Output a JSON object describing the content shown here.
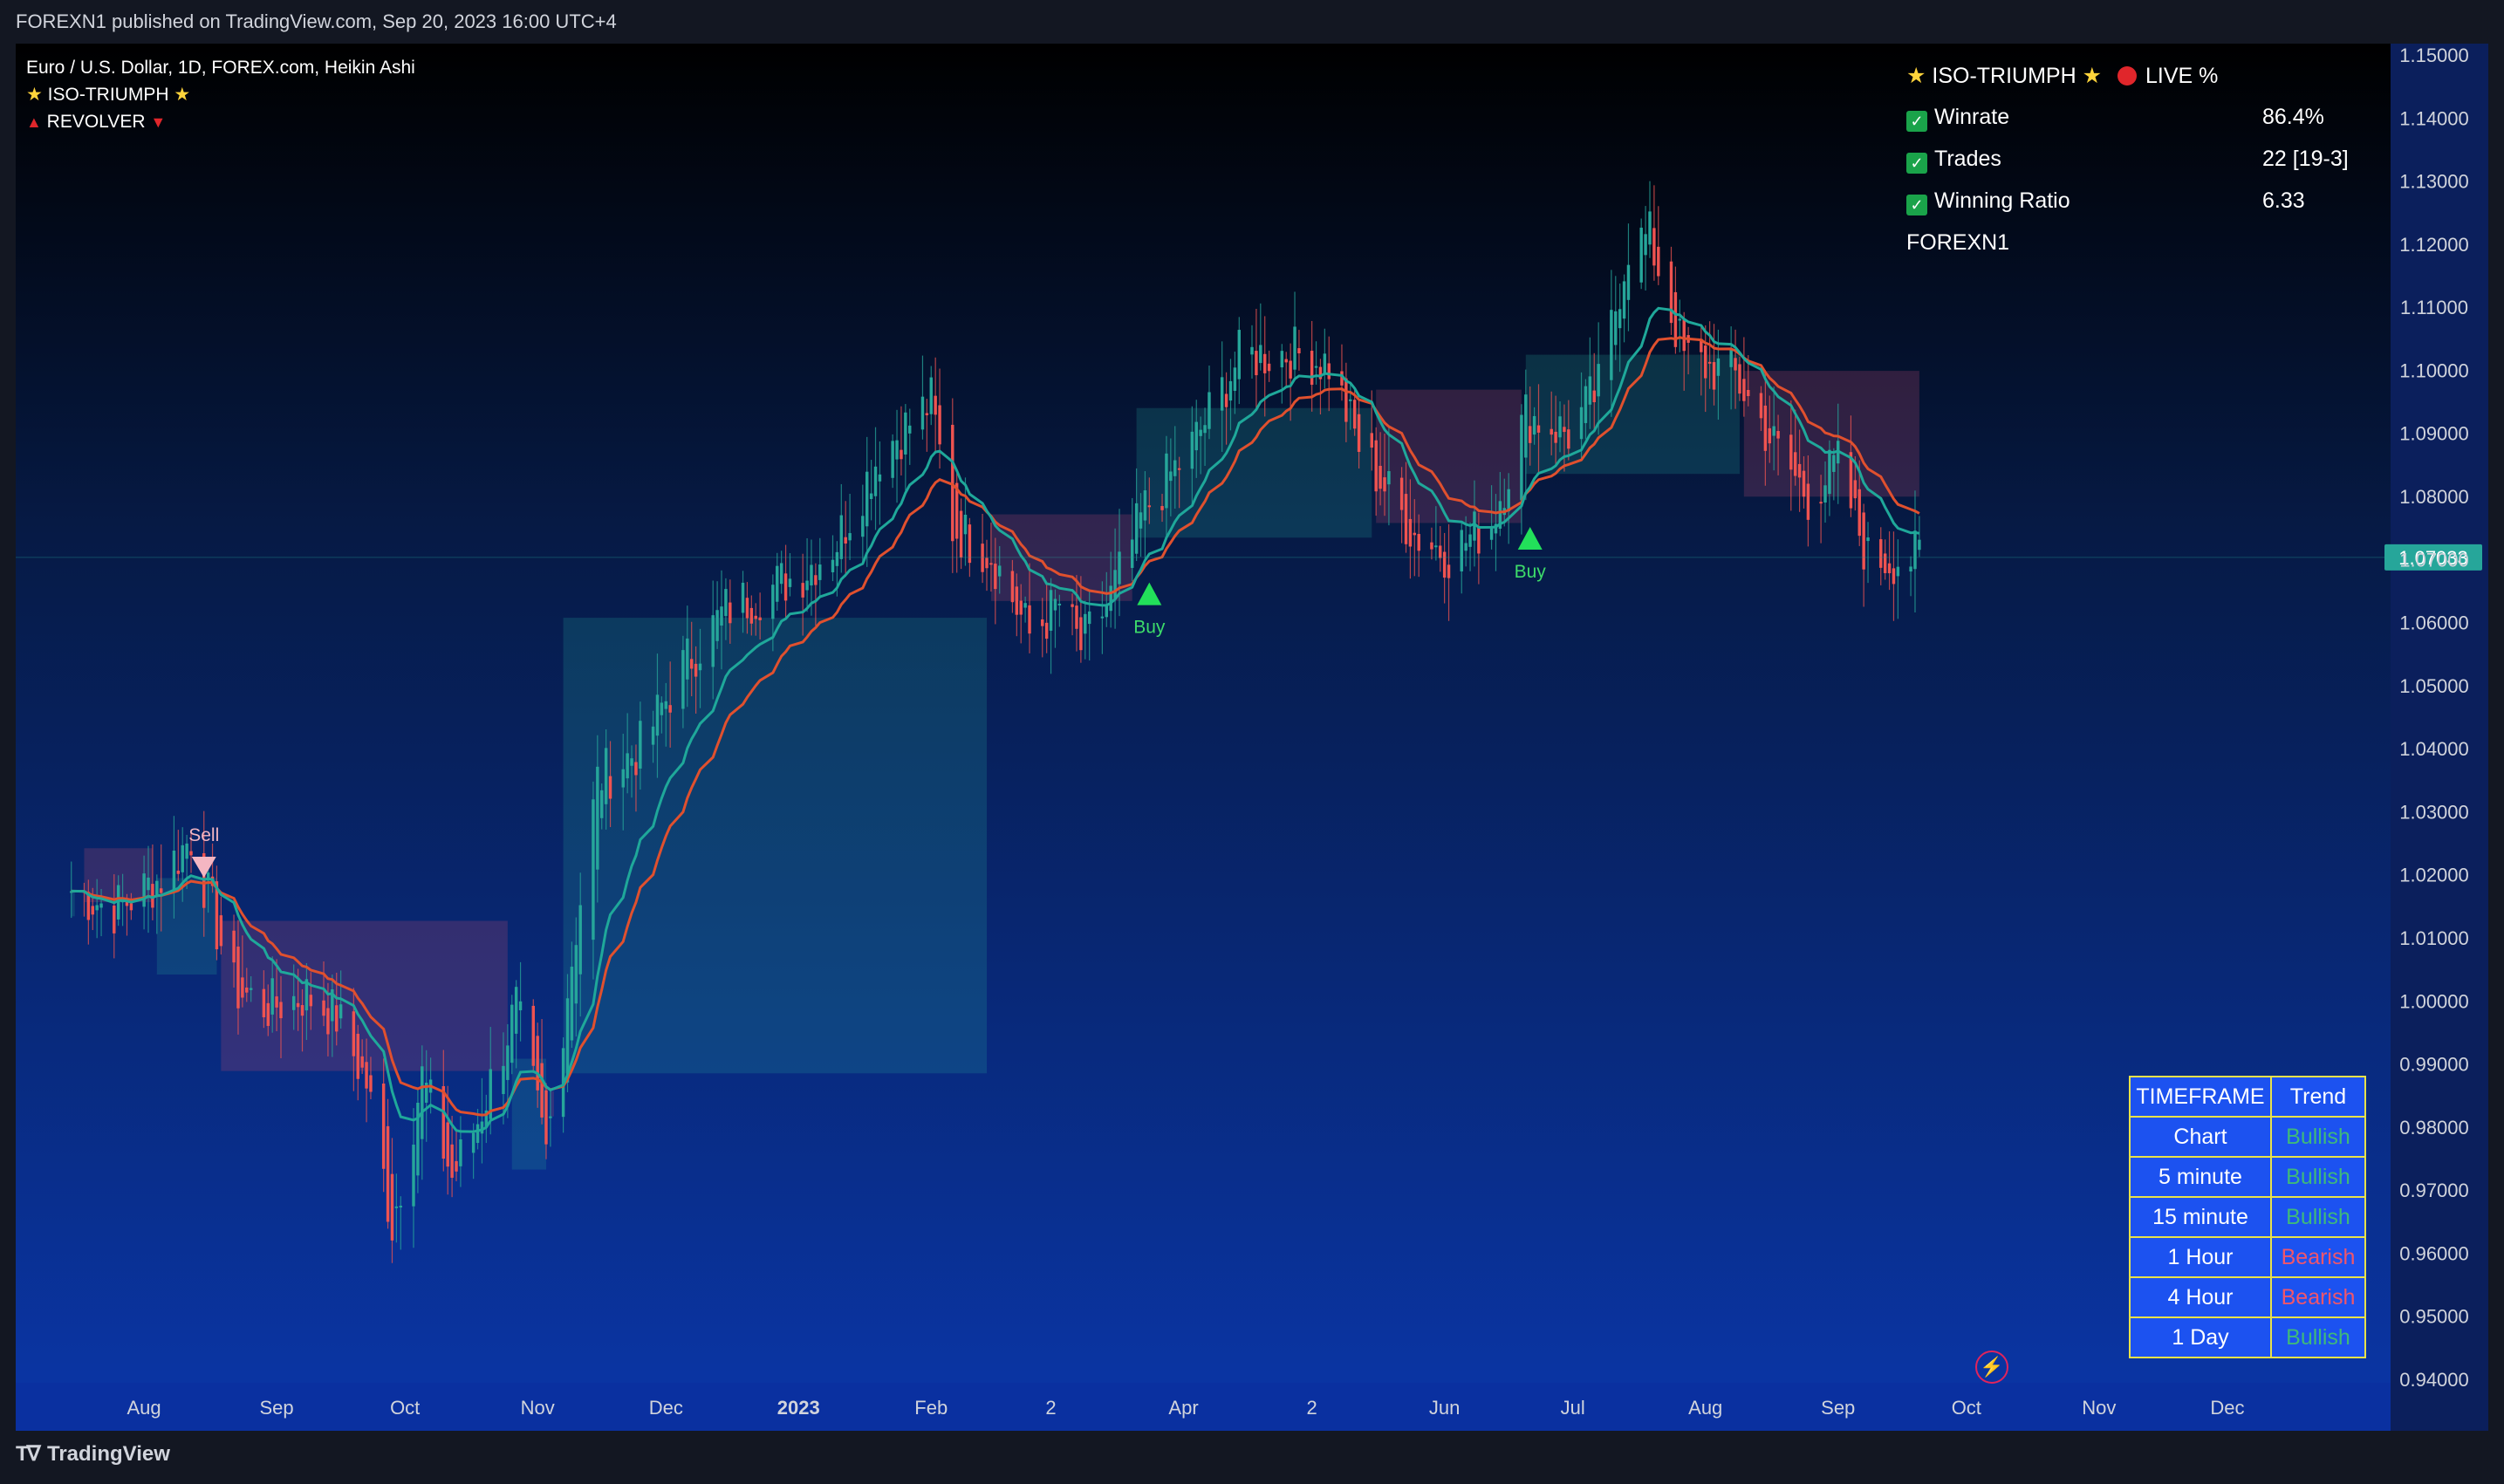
{
  "header": {
    "published": "FOREXN1 published on TradingView.com, Sep 20, 2023 16:00 UTC+4"
  },
  "footer": {
    "brand": "TradingView",
    "logo_icon": "tradingview-logo-icon"
  },
  "legend": {
    "symbol": "Euro / U.S. Dollar, 1D, FOREX.com, Heikin Ashi",
    "indicator1": "ISO-TRIUMPH",
    "indicator2": "REVOLVER"
  },
  "stats": {
    "title": "ISO-TRIUMPH",
    "live": "LIVE %",
    "rows": [
      {
        "label": "Winrate",
        "value": "86.4%"
      },
      {
        "label": "Trades",
        "value": "22 [19-3]"
      },
      {
        "label": "Winning Ratio",
        "value": "6.33"
      }
    ],
    "author": "FOREXN1"
  },
  "trend_table": {
    "headers": [
      "TIMEFRAME",
      "Trend"
    ],
    "rows": [
      {
        "timeframe": "Chart",
        "trend": "Bullish"
      },
      {
        "timeframe": "5 minute",
        "trend": "Bullish"
      },
      {
        "timeframe": "15 minute",
        "trend": "Bullish"
      },
      {
        "timeframe": "1 Hour",
        "trend": "Bearish"
      },
      {
        "timeframe": "4 Hour",
        "trend": "Bearish"
      },
      {
        "timeframe": "1 Day",
        "trend": "Bullish"
      }
    ]
  },
  "colors": {
    "bull": "#26a69a",
    "bear": "#ef5350",
    "bullish_text": "#3fb97a",
    "bearish_text": "#f0566b",
    "price_tag": "#26a69a",
    "table_cell": "#1c52f0",
    "table_border": "#e8e24a"
  },
  "chart_data": {
    "type": "candlestick",
    "y_ticks": [
      "1.15000",
      "1.14000",
      "1.13000",
      "1.12000",
      "1.11000",
      "1.10000",
      "1.09000",
      "1.08000",
      "1.07000",
      "1.06000",
      "1.05000",
      "1.04000",
      "1.03000",
      "1.02000",
      "1.01000",
      "1.00000",
      "0.99000",
      "0.98000",
      "0.97000",
      "0.96000",
      "0.95000",
      "0.94000"
    ],
    "ylim": [
      0.94,
      1.15
    ],
    "x_ticks": [
      "Aug",
      "Sep",
      "Oct",
      "Nov",
      "Dec",
      "2023",
      "Feb",
      "2",
      "Apr",
      "2",
      "Jun",
      "Jul",
      "Aug",
      "Sep",
      "Oct",
      "Nov",
      "Dec"
    ],
    "last_price": "1.07033",
    "price_path": [
      [
        "2022-07-15",
        1.0175
      ],
      [
        "2022-07-25",
        1.0145
      ],
      [
        "2022-08-05",
        1.0195
      ],
      [
        "2022-08-12",
        1.026
      ],
      [
        "2022-08-22",
        1.002
      ],
      [
        "2022-08-30",
        0.999
      ],
      [
        "2022-09-08",
        1.001
      ],
      [
        "2022-09-15",
        0.9975
      ],
      [
        "2022-09-22",
        0.987
      ],
      [
        "2022-09-28",
        0.9645
      ],
      [
        "2022-10-05",
        0.988
      ],
      [
        "2022-10-12",
        0.972
      ],
      [
        "2022-10-18",
        0.981
      ],
      [
        "2022-10-27",
        0.999
      ],
      [
        "2022-11-03",
        0.976
      ],
      [
        "2022-11-08",
        1.002
      ],
      [
        "2022-11-15",
        1.035
      ],
      [
        "2022-11-25",
        1.04
      ],
      [
        "2022-12-05",
        1.053
      ],
      [
        "2022-12-15",
        1.062
      ],
      [
        "2023-01-02",
        1.068
      ],
      [
        "2023-01-10",
        1.073
      ],
      [
        "2023-01-20",
        1.087
      ],
      [
        "2023-02-01",
        1.095
      ],
      [
        "2023-02-06",
        1.075
      ],
      [
        "2023-02-15",
        1.071
      ],
      [
        "2023-02-24",
        1.058
      ],
      [
        "2023-03-03",
        1.063
      ],
      [
        "2023-03-08",
        1.056
      ],
      [
        "2023-03-15",
        1.064
      ],
      [
        "2023-03-23",
        1.078
      ],
      [
        "2023-04-03",
        1.088
      ],
      [
        "2023-04-14",
        1.102
      ],
      [
        "2023-04-26",
        1.103
      ],
      [
        "2023-05-05",
        1.101
      ],
      [
        "2023-05-12",
        1.088
      ],
      [
        "2023-05-25",
        1.074
      ],
      [
        "2023-06-02",
        1.071
      ],
      [
        "2023-06-12",
        1.076
      ],
      [
        "2023-06-20",
        1.093
      ],
      [
        "2023-06-30",
        1.09
      ],
      [
        "2023-07-07",
        1.097
      ],
      [
        "2023-07-14",
        1.12
      ],
      [
        "2023-07-19",
        1.121
      ],
      [
        "2023-07-27",
        1.102
      ],
      [
        "2023-08-08",
        1.099
      ],
      [
        "2023-08-18",
        1.087
      ],
      [
        "2023-08-25",
        1.08
      ],
      [
        "2023-09-01",
        1.085
      ],
      [
        "2023-09-08",
        1.07
      ],
      [
        "2023-09-20",
        1.0703
      ]
    ],
    "signals": [
      {
        "label": "Sell",
        "date": "2022-08-15",
        "price": 1.0212
      },
      {
        "label": "Buy",
        "date": "2023-03-24",
        "price": 1.0647
      },
      {
        "label": "Buy",
        "date": "2023-06-21",
        "price": 1.0735
      }
    ],
    "watermark_series": [
      "ISO-TRIUMPH",
      "REVOLVER"
    ]
  }
}
